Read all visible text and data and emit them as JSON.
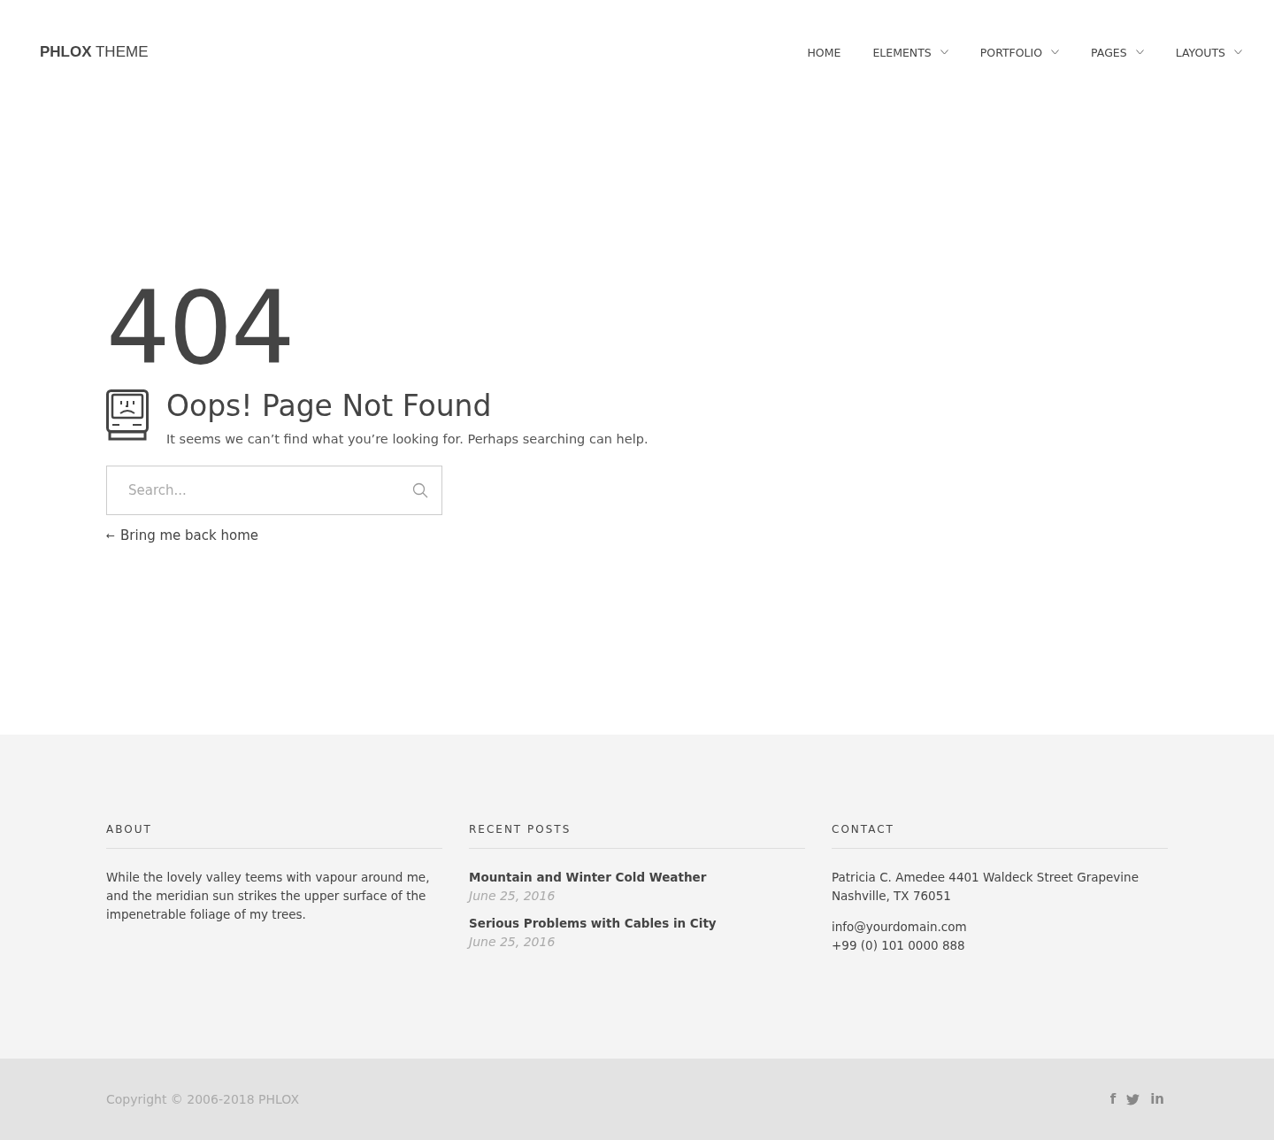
{
  "header": {
    "logo": {
      "bold": "PHLOX",
      "light": "THEME"
    },
    "nav": [
      {
        "label": "HOME",
        "has_dropdown": false
      },
      {
        "label": "ELEMENTS",
        "has_dropdown": true
      },
      {
        "label": "PORTFOLIO",
        "has_dropdown": true
      },
      {
        "label": "PAGES",
        "has_dropdown": true
      },
      {
        "label": "LAYOUTS",
        "has_dropdown": true
      }
    ]
  },
  "error": {
    "code": "404",
    "title": "Oops! Page Not Found",
    "message": "It seems we can’t find what you’re looking for. Perhaps searching can help.",
    "search": {
      "placeholder": "Search..."
    },
    "back_arrow": "←",
    "back_link": "Bring me back home"
  },
  "footer": {
    "about": {
      "heading": "ABOUT",
      "text": "While the lovely valley teems with vapour around me, and the meridian sun strikes the upper surface of the impenetrable foliage of my trees."
    },
    "recent_posts": {
      "heading": "RECENT POSTS",
      "posts": [
        {
          "title": "Mountain and Winter Cold Weather",
          "date": "June 25, 2016"
        },
        {
          "title": "Serious Problems with Cables in City",
          "date": "June 25, 2016"
        }
      ]
    },
    "contact": {
      "heading": "CONTACT",
      "address": "Patricia C. Amedee 4401 Waldeck Street Grapevine Nashville, TX 76051",
      "email": "info@yourdomain.com",
      "phone": "+99 (0) 101 0000 888"
    }
  },
  "bottom_bar": {
    "copyright": "Copyright © 2006-2018 PHLOX",
    "social": [
      {
        "kind": "text",
        "label": "f"
      },
      {
        "kind": "bird"
      },
      {
        "kind": "text",
        "label": "in"
      }
    ]
  }
}
